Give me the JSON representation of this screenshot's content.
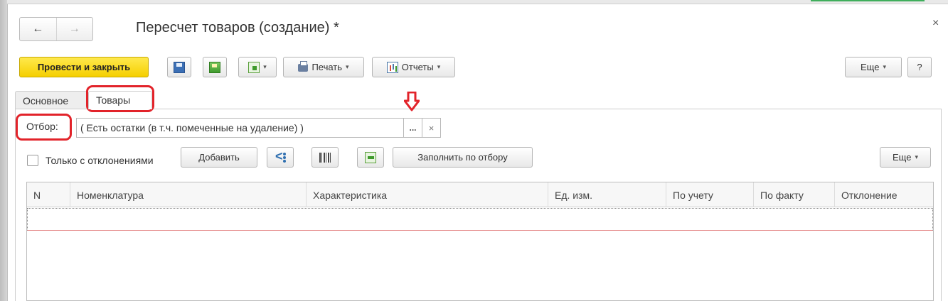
{
  "window": {
    "title": "Пересчет товаров (создание) *",
    "close_glyph": "×"
  },
  "nav": {
    "back": "←",
    "forward": "→"
  },
  "toolbar": {
    "post_and_close": "Провести и закрыть",
    "print": "Печать",
    "reports": "Отчеты",
    "more": "Еще",
    "help": "?",
    "dropdown_glyph": "▾"
  },
  "tabs": [
    {
      "label": "Основное",
      "active": false
    },
    {
      "label": "Товары",
      "active": true
    }
  ],
  "filter": {
    "label": "Отбор:",
    "value": "( Есть остатки (в т.ч. помеченные на удаление) )",
    "select_glyph": "...",
    "clear_glyph": "×"
  },
  "items_toolbar": {
    "only_deviations_label": "Только с отклонениями",
    "only_deviations_checked": false,
    "add": "Добавить",
    "fill_by_filter": "Заполнить по отбору",
    "more": "Еще"
  },
  "table": {
    "columns": [
      "N",
      "Номенклатура",
      "Характеристика",
      "Ед. изм.",
      "По учету",
      "По факту",
      "Отклонение"
    ],
    "rows": []
  },
  "colors": {
    "primary_button": "#f5cf00",
    "annotation": "#e2232a"
  }
}
